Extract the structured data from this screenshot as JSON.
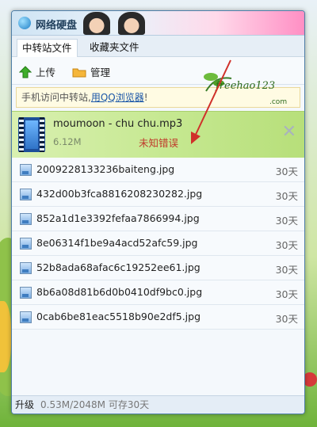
{
  "window": {
    "title": "网络硬盘"
  },
  "tabs": [
    {
      "label": "中转站文件"
    },
    {
      "label": "收藏夹文件"
    }
  ],
  "toolbar": {
    "upload_label": "上传",
    "manage_label": "管理"
  },
  "notice": {
    "prefix": "手机访问中转站,",
    "link": "用QQ浏览器",
    "suffix": "!"
  },
  "watermark": {
    "text": "freehao123",
    "suffix": ".com"
  },
  "active_file": {
    "name": "moumoon - chu chu.mp3",
    "size": "6.12M",
    "status": "未知错误"
  },
  "files": [
    {
      "name": "2009228133236baiteng.jpg",
      "days": "30天"
    },
    {
      "name": "432d00b3fca8816208230282.jpg",
      "days": "30天"
    },
    {
      "name": "852a1d1e3392fefaa7866994.jpg",
      "days": "30天"
    },
    {
      "name": "8e06314f1be9a4acd52afc59.jpg",
      "days": "30天"
    },
    {
      "name": "52b8ada68afac6c19252ee61.jpg",
      "days": "30天"
    },
    {
      "name": "8b6a08d81b6d0b0410df9bc0.jpg",
      "days": "30天"
    },
    {
      "name": "0cab6be81eac5518b90e2df5.jpg",
      "days": "30天"
    }
  ],
  "status": {
    "upgrade_label": "升级",
    "quota": "0.53M/2048M 可存30天"
  },
  "colors": {
    "accent_green": "#c5e890",
    "error_red": "#c0392b",
    "link_blue": "#1b57a8"
  }
}
